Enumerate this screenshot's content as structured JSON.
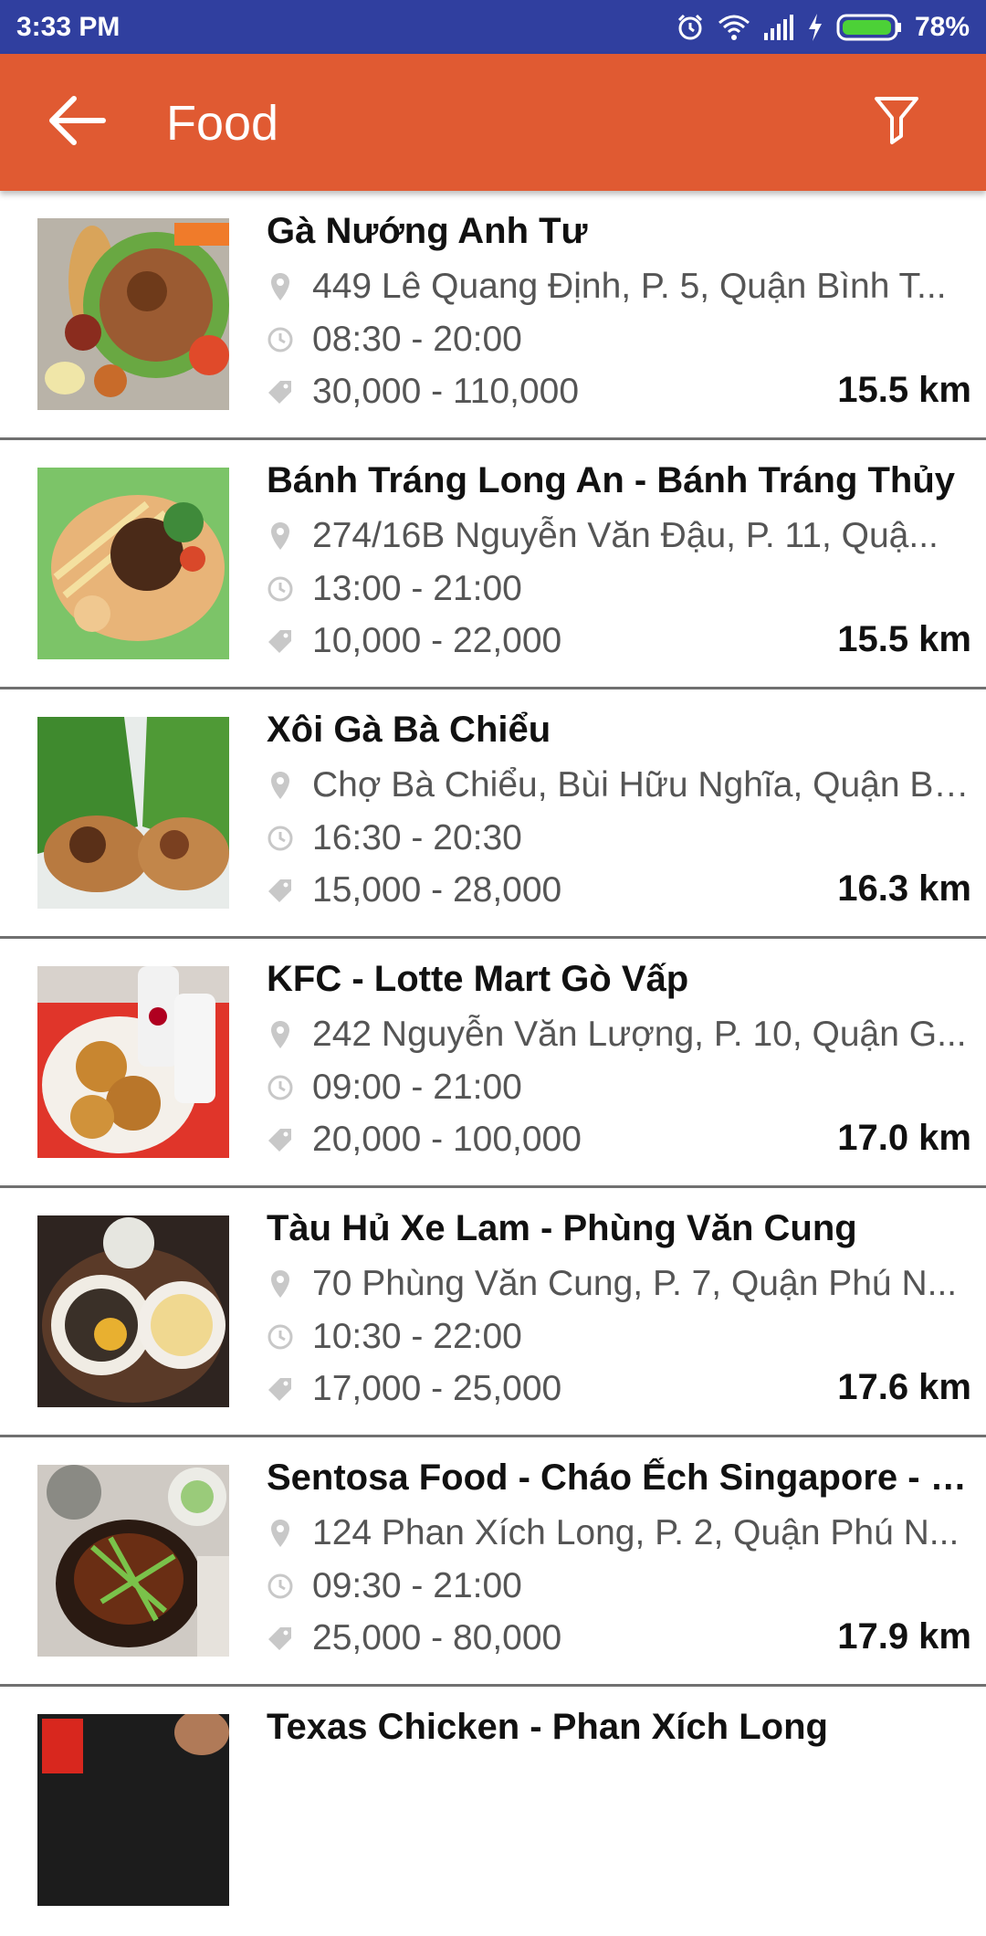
{
  "status_bar": {
    "time": "3:33 PM",
    "battery": "78%",
    "icons": [
      "alarm-icon",
      "wifi-icon",
      "signal-icon",
      "charging-icon",
      "battery-icon"
    ]
  },
  "app_bar": {
    "title": "Food",
    "back_icon": "arrow-left-icon",
    "filter_icon": "filter-icon",
    "color": "#e05a32"
  },
  "items": [
    {
      "name": "Gà Nướng Anh Tư",
      "address": "449 Lê Quang Định, P. 5, Quận Bình T...",
      "hours": "08:30 - 20:00",
      "price": "30,000 - 110,000",
      "distance": "15.5 km"
    },
    {
      "name": "Bánh Tráng Long An - Bánh Tráng Thủy",
      "address": "274/16B Nguyễn Văn Đậu, P. 11, Quậ...",
      "hours": "13:00 - 21:00",
      "price": "10,000 - 22,000",
      "distance": "15.5 km"
    },
    {
      "name": "Xôi Gà Bà Chiểu",
      "address": "Chợ Bà Chiểu, Bùi Hữu Nghĩa, Quận Bì...",
      "hours": "16:30 - 20:30",
      "price": "15,000 - 28,000",
      "distance": "16.3 km"
    },
    {
      "name": "KFC - Lotte Mart Gò Vấp",
      "address": "242 Nguyễn Văn Lượng, P. 10, Quận G...",
      "hours": "09:00 - 21:00",
      "price": "20,000 - 100,000",
      "distance": "17.0 km"
    },
    {
      "name": "Tàu Hủ Xe Lam - Phùng Văn Cung",
      "address": "70 Phùng Văn Cung, P. 7, Quận Phú N...",
      "hours": "10:30 - 22:00",
      "price": "17,000 - 25,000",
      "distance": "17.6 km"
    },
    {
      "name": "Sentosa Food - Cháo Ếch Singapore - P...",
      "address": "124 Phan Xích Long, P. 2, Quận Phú N...",
      "hours": "09:30 - 21:00",
      "price": "25,000 - 80,000",
      "distance": "17.9 km"
    },
    {
      "name": "Texas Chicken - Phan Xích Long",
      "address": "",
      "hours": "",
      "price": "",
      "distance": ""
    }
  ]
}
